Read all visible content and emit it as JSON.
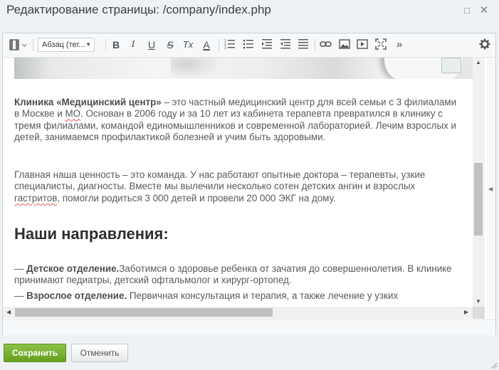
{
  "window": {
    "title": "Редактирование страницы: /company/index.php",
    "restore_icon": "□",
    "close_icon": "✕"
  },
  "toolbar": {
    "format_select": "Абзац (тег...",
    "tools": [
      {
        "name": "bold-button",
        "icon": "bold-icon",
        "glyph": "B"
      },
      {
        "name": "italic-button",
        "icon": "italic-icon",
        "glyph": "I"
      },
      {
        "name": "underline-button",
        "icon": "underline-icon",
        "glyph": "U"
      },
      {
        "name": "strikethrough-button",
        "icon": "strikethrough-icon",
        "glyph": "S"
      },
      {
        "name": "remove-format-button",
        "icon": "remove-format-icon",
        "glyph": "Tx"
      },
      {
        "name": "font-color-button",
        "icon": "font-color-icon",
        "glyph": "A"
      },
      {
        "name": "ordered-list-button",
        "icon": "ordered-list-icon"
      },
      {
        "name": "unordered-list-button",
        "icon": "unordered-list-icon"
      },
      {
        "name": "indent-button",
        "icon": "indent-icon"
      },
      {
        "name": "outdent-button",
        "icon": "outdent-icon"
      },
      {
        "name": "align-button",
        "icon": "align-icon"
      },
      {
        "name": "link-button",
        "icon": "link-icon"
      },
      {
        "name": "image-button",
        "icon": "image-icon"
      },
      {
        "name": "video-button",
        "icon": "video-icon"
      },
      {
        "name": "fullscreen-button",
        "icon": "fullscreen-icon"
      },
      {
        "name": "more-button",
        "icon": "more-icon",
        "glyph": "»"
      },
      {
        "name": "settings-button",
        "icon": "gear-icon"
      }
    ]
  },
  "content": {
    "p1_bold": "Клиника «Медицинский центр»",
    "p1_text_a": " – это частный медицинский центр для всей семьи с 3 филиалами в Москве и ",
    "p1_underlined": "МО",
    "p1_text_b": ". Основан в 2006 году и за 10 лет из кабинета терапевта превратился в клинику с тремя филиалами, командой единомышленников и современной лабораторией. Лечим взрослых и детей, занимаемся профилактикой болезней и учим быть здоровыми.",
    "p2_text_a": "Главная наша ценность – это команда. У нас работают опытные доктора – терапевты, узкие специалисты, диагносты. Вместе мы вылечили несколько сотен детских ангин и взрослых ",
    "p2_underlined": "гастритов",
    "p2_text_b": ", помогли родиться 3 000 детей и провели 20 000 ЭКГ на дому.",
    "heading": "Наши направления:",
    "items": [
      {
        "dash": "— ",
        "bold": "Детское отделение.",
        "text": "Заботимся о здоровье ребенка от зачатия до совершеннолетия. В клинике принимают педиатры, детский офтальмолог и хирург-ортопед."
      },
      {
        "dash": "— ",
        "bold": "Взрослое отделение.",
        "text": " Первичная консультация и терапия, а также лечение у узких"
      }
    ]
  },
  "buttons": {
    "save": "Сохранить",
    "cancel": "Отменить"
  }
}
